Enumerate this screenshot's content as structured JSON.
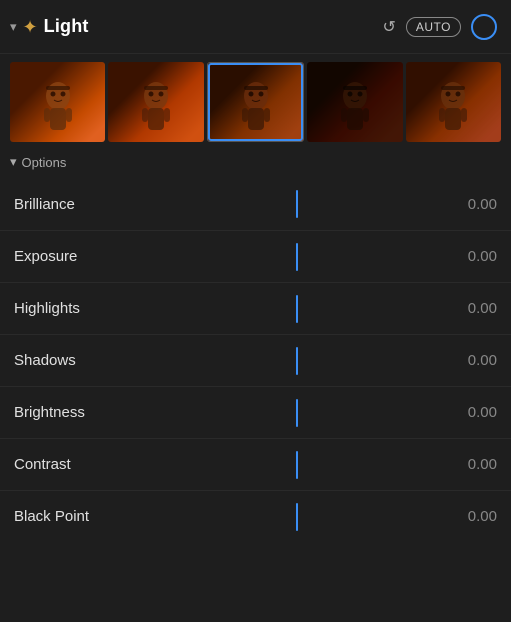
{
  "header": {
    "title": "Light",
    "chevron": "▾",
    "sun_symbol": "☀",
    "undo_symbol": "↺",
    "auto_label": "AUTO"
  },
  "options_label": "Options",
  "thumbnails": [
    {
      "id": 0,
      "selected": false
    },
    {
      "id": 1,
      "selected": false
    },
    {
      "id": 2,
      "selected": true
    },
    {
      "id": 3,
      "selected": false
    },
    {
      "id": 4,
      "selected": false
    }
  ],
  "sliders": [
    {
      "label": "Brilliance",
      "value": "0.00"
    },
    {
      "label": "Exposure",
      "value": "0.00"
    },
    {
      "label": "Highlights",
      "value": "0.00"
    },
    {
      "label": "Shadows",
      "value": "0.00"
    },
    {
      "label": "Brightness",
      "value": "0.00"
    },
    {
      "label": "Contrast",
      "value": "0.00"
    },
    {
      "label": "Black Point",
      "value": "0.00"
    }
  ]
}
